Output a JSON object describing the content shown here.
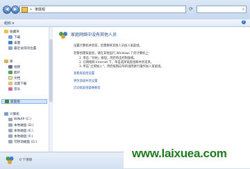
{
  "address": {
    "crumb1": "»",
    "location": "家庭组"
  },
  "search": {
    "placeholder": "搜索..."
  },
  "toolbar": {
    "organize": "组织 ▾",
    "help": "?"
  },
  "nav": {
    "favorites": "收藏夹",
    "downloads": "下载",
    "desktop": "桌面",
    "recent": "最近访问的位置",
    "libraries": "库",
    "videos": "视频",
    "pictures": "图片",
    "documents": "文档",
    "thunder": "迅雷下载",
    "music": "音乐",
    "homegroup": "家庭组",
    "computer": "计算机",
    "drive_c": "WINXP (C:)",
    "drive_d": "本地磁盘 (D:)",
    "drive_e": "本地磁盘 (E:)",
    "drive_f": "本地磁盘 (F:)",
    "drive_g": "可移动磁盘 (G:)"
  },
  "main": {
    "heading": "家庭网络中没有其他人员",
    "desc": "设置计算机共享前，您需要将其他人员加入家庭组。",
    "intro": "若要创建家庭组，请在其他运行 Windows 7 的计算机上：",
    "step1": "1.    单击「开始」按钮，然后单击控制面板。",
    "step2": "2.    在网络和 Internet 下，单击选择家庭组和共享选项。",
    "step3": "3.    单击“立即加入”，然后按照向导的说明进行操作加入家庭组。",
    "link1": "查看家庭组设置",
    "link2": "更改高级共享设置",
    "link3": "启动家庭组疑难解答"
  },
  "status": {
    "items": "0 个项目"
  },
  "watermark": "www.laixuea.com"
}
